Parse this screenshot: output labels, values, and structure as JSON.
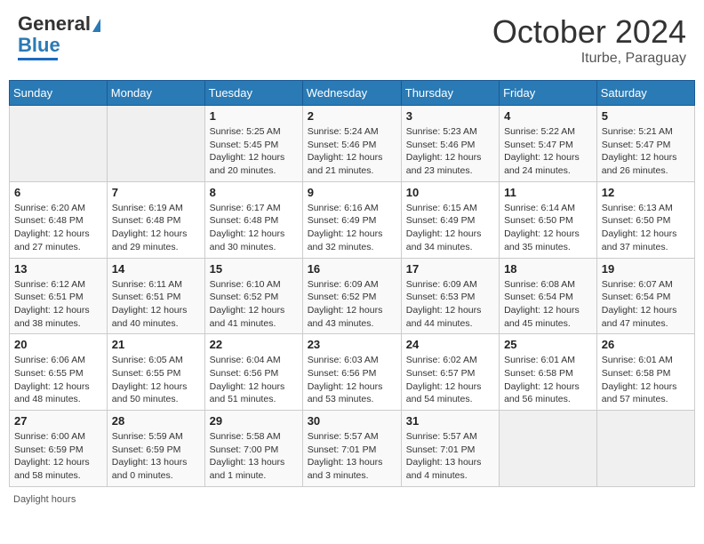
{
  "header": {
    "logo_line1": "General",
    "logo_line2": "Blue",
    "month": "October 2024",
    "location": "Iturbe, Paraguay"
  },
  "weekdays": [
    "Sunday",
    "Monday",
    "Tuesday",
    "Wednesday",
    "Thursday",
    "Friday",
    "Saturday"
  ],
  "weeks": [
    [
      {
        "day": "",
        "sunrise": "",
        "sunset": "",
        "daylight": ""
      },
      {
        "day": "",
        "sunrise": "",
        "sunset": "",
        "daylight": ""
      },
      {
        "day": "1",
        "sunrise": "Sunrise: 5:25 AM",
        "sunset": "Sunset: 5:45 PM",
        "daylight": "Daylight: 12 hours and 20 minutes."
      },
      {
        "day": "2",
        "sunrise": "Sunrise: 5:24 AM",
        "sunset": "Sunset: 5:46 PM",
        "daylight": "Daylight: 12 hours and 21 minutes."
      },
      {
        "day": "3",
        "sunrise": "Sunrise: 5:23 AM",
        "sunset": "Sunset: 5:46 PM",
        "daylight": "Daylight: 12 hours and 23 minutes."
      },
      {
        "day": "4",
        "sunrise": "Sunrise: 5:22 AM",
        "sunset": "Sunset: 5:47 PM",
        "daylight": "Daylight: 12 hours and 24 minutes."
      },
      {
        "day": "5",
        "sunrise": "Sunrise: 5:21 AM",
        "sunset": "Sunset: 5:47 PM",
        "daylight": "Daylight: 12 hours and 26 minutes."
      }
    ],
    [
      {
        "day": "6",
        "sunrise": "Sunrise: 6:20 AM",
        "sunset": "Sunset: 6:48 PM",
        "daylight": "Daylight: 12 hours and 27 minutes."
      },
      {
        "day": "7",
        "sunrise": "Sunrise: 6:19 AM",
        "sunset": "Sunset: 6:48 PM",
        "daylight": "Daylight: 12 hours and 29 minutes."
      },
      {
        "day": "8",
        "sunrise": "Sunrise: 6:17 AM",
        "sunset": "Sunset: 6:48 PM",
        "daylight": "Daylight: 12 hours and 30 minutes."
      },
      {
        "day": "9",
        "sunrise": "Sunrise: 6:16 AM",
        "sunset": "Sunset: 6:49 PM",
        "daylight": "Daylight: 12 hours and 32 minutes."
      },
      {
        "day": "10",
        "sunrise": "Sunrise: 6:15 AM",
        "sunset": "Sunset: 6:49 PM",
        "daylight": "Daylight: 12 hours and 34 minutes."
      },
      {
        "day": "11",
        "sunrise": "Sunrise: 6:14 AM",
        "sunset": "Sunset: 6:50 PM",
        "daylight": "Daylight: 12 hours and 35 minutes."
      },
      {
        "day": "12",
        "sunrise": "Sunrise: 6:13 AM",
        "sunset": "Sunset: 6:50 PM",
        "daylight": "Daylight: 12 hours and 37 minutes."
      }
    ],
    [
      {
        "day": "13",
        "sunrise": "Sunrise: 6:12 AM",
        "sunset": "Sunset: 6:51 PM",
        "daylight": "Daylight: 12 hours and 38 minutes."
      },
      {
        "day": "14",
        "sunrise": "Sunrise: 6:11 AM",
        "sunset": "Sunset: 6:51 PM",
        "daylight": "Daylight: 12 hours and 40 minutes."
      },
      {
        "day": "15",
        "sunrise": "Sunrise: 6:10 AM",
        "sunset": "Sunset: 6:52 PM",
        "daylight": "Daylight: 12 hours and 41 minutes."
      },
      {
        "day": "16",
        "sunrise": "Sunrise: 6:09 AM",
        "sunset": "Sunset: 6:52 PM",
        "daylight": "Daylight: 12 hours and 43 minutes."
      },
      {
        "day": "17",
        "sunrise": "Sunrise: 6:09 AM",
        "sunset": "Sunset: 6:53 PM",
        "daylight": "Daylight: 12 hours and 44 minutes."
      },
      {
        "day": "18",
        "sunrise": "Sunrise: 6:08 AM",
        "sunset": "Sunset: 6:54 PM",
        "daylight": "Daylight: 12 hours and 45 minutes."
      },
      {
        "day": "19",
        "sunrise": "Sunrise: 6:07 AM",
        "sunset": "Sunset: 6:54 PM",
        "daylight": "Daylight: 12 hours and 47 minutes."
      }
    ],
    [
      {
        "day": "20",
        "sunrise": "Sunrise: 6:06 AM",
        "sunset": "Sunset: 6:55 PM",
        "daylight": "Daylight: 12 hours and 48 minutes."
      },
      {
        "day": "21",
        "sunrise": "Sunrise: 6:05 AM",
        "sunset": "Sunset: 6:55 PM",
        "daylight": "Daylight: 12 hours and 50 minutes."
      },
      {
        "day": "22",
        "sunrise": "Sunrise: 6:04 AM",
        "sunset": "Sunset: 6:56 PM",
        "daylight": "Daylight: 12 hours and 51 minutes."
      },
      {
        "day": "23",
        "sunrise": "Sunrise: 6:03 AM",
        "sunset": "Sunset: 6:56 PM",
        "daylight": "Daylight: 12 hours and 53 minutes."
      },
      {
        "day": "24",
        "sunrise": "Sunrise: 6:02 AM",
        "sunset": "Sunset: 6:57 PM",
        "daylight": "Daylight: 12 hours and 54 minutes."
      },
      {
        "day": "25",
        "sunrise": "Sunrise: 6:01 AM",
        "sunset": "Sunset: 6:58 PM",
        "daylight": "Daylight: 12 hours and 56 minutes."
      },
      {
        "day": "26",
        "sunrise": "Sunrise: 6:01 AM",
        "sunset": "Sunset: 6:58 PM",
        "daylight": "Daylight: 12 hours and 57 minutes."
      }
    ],
    [
      {
        "day": "27",
        "sunrise": "Sunrise: 6:00 AM",
        "sunset": "Sunset: 6:59 PM",
        "daylight": "Daylight: 12 hours and 58 minutes."
      },
      {
        "day": "28",
        "sunrise": "Sunrise: 5:59 AM",
        "sunset": "Sunset: 6:59 PM",
        "daylight": "Daylight: 13 hours and 0 minutes."
      },
      {
        "day": "29",
        "sunrise": "Sunrise: 5:58 AM",
        "sunset": "Sunset: 7:00 PM",
        "daylight": "Daylight: 13 hours and 1 minute."
      },
      {
        "day": "30",
        "sunrise": "Sunrise: 5:57 AM",
        "sunset": "Sunset: 7:01 PM",
        "daylight": "Daylight: 13 hours and 3 minutes."
      },
      {
        "day": "31",
        "sunrise": "Sunrise: 5:57 AM",
        "sunset": "Sunset: 7:01 PM",
        "daylight": "Daylight: 13 hours and 4 minutes."
      },
      {
        "day": "",
        "sunrise": "",
        "sunset": "",
        "daylight": ""
      },
      {
        "day": "",
        "sunrise": "",
        "sunset": "",
        "daylight": ""
      }
    ]
  ],
  "footer": "Daylight hours"
}
